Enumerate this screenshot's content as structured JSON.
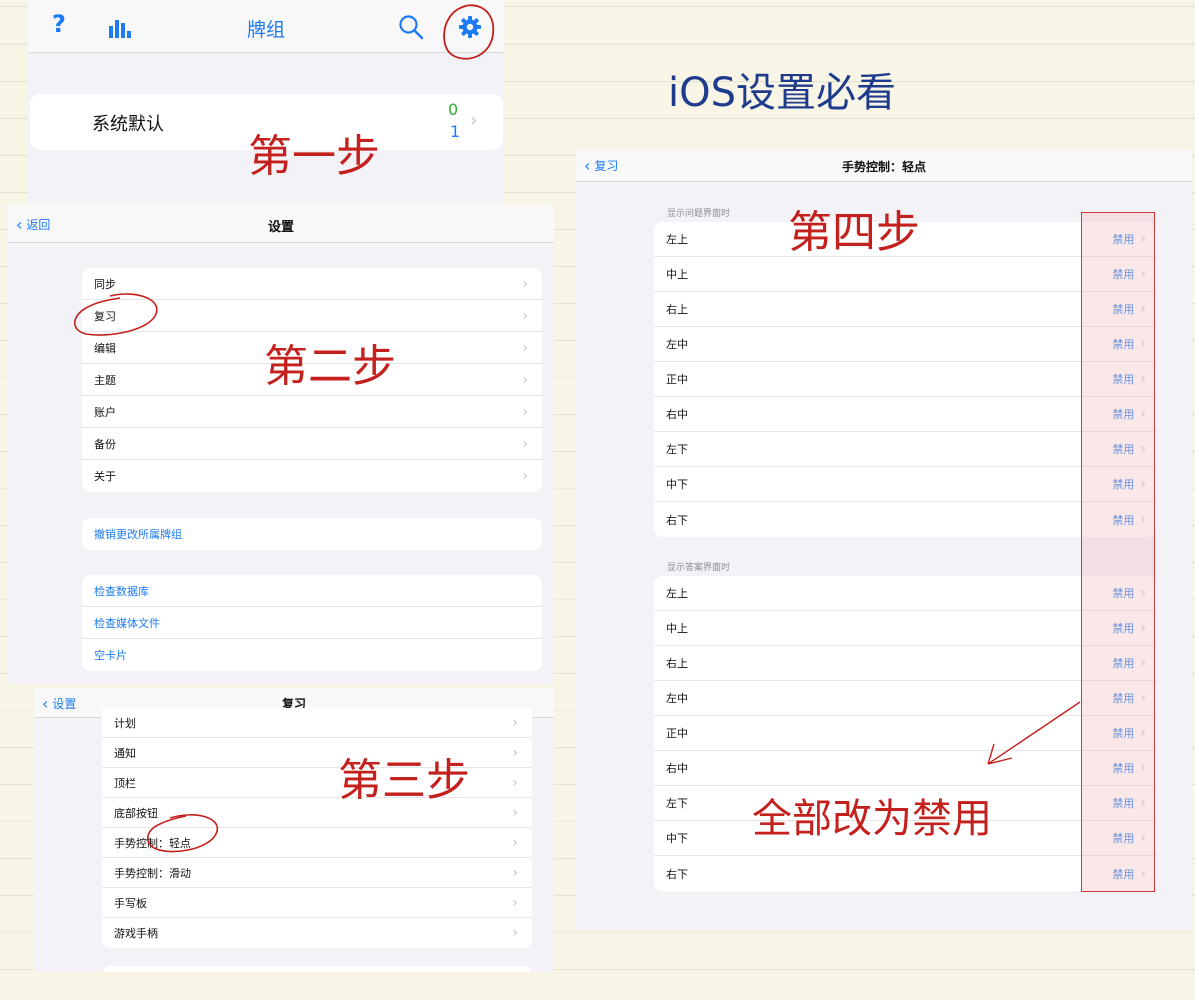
{
  "page_title": "iOS设置必看",
  "annotations": {
    "step1": "第一步",
    "step2": "第二步",
    "step3": "第三步",
    "step4": "第四步",
    "note": "全部改为禁用"
  },
  "panel1": {
    "help_icon": "?",
    "title": "牌组",
    "deck": {
      "name": "系统默认",
      "count_new": "0",
      "count_review": "1"
    }
  },
  "panel2": {
    "back_label": "返回",
    "title": "设置",
    "group1": [
      "同步",
      "复习",
      "编辑",
      "主题",
      "账户",
      "备份",
      "关于"
    ],
    "group2": [
      "撤销更改所属牌组"
    ],
    "group3": [
      "检查数据库",
      "检查媒体文件",
      "空卡片"
    ]
  },
  "panel3": {
    "back_label": "设置",
    "title": "复习",
    "items": [
      "计划",
      "通知",
      "顶栏",
      "底部按钮",
      "手势控制：轻点",
      "手势控制：滑动",
      "手写板",
      "游戏手柄"
    ]
  },
  "panel4": {
    "back_label": "复习",
    "title": "手势控制：轻点",
    "section1": {
      "header": "显示问题界面时",
      "rows": [
        {
          "label": "左上",
          "value": "禁用"
        },
        {
          "label": "中上",
          "value": "禁用"
        },
        {
          "label": "右上",
          "value": "禁用"
        },
        {
          "label": "左中",
          "value": "禁用"
        },
        {
          "label": "正中",
          "value": "禁用"
        },
        {
          "label": "右中",
          "value": "禁用"
        },
        {
          "label": "左下",
          "value": "禁用"
        },
        {
          "label": "中下",
          "value": "禁用"
        },
        {
          "label": "右下",
          "value": "禁用"
        }
      ]
    },
    "section2": {
      "header": "显示答案界面时",
      "rows": [
        {
          "label": "左上",
          "value": "禁用"
        },
        {
          "label": "中上",
          "value": "禁用"
        },
        {
          "label": "右上",
          "value": "禁用"
        },
        {
          "label": "左中",
          "value": "禁用"
        },
        {
          "label": "正中",
          "value": "禁用"
        },
        {
          "label": "右中",
          "value": "禁用"
        },
        {
          "label": "左下",
          "value": "禁用"
        },
        {
          "label": "中下",
          "value": "禁用"
        },
        {
          "label": "右下",
          "value": "禁用"
        }
      ]
    }
  },
  "colors": {
    "ios_blue": "#1d7bf2",
    "annotation_red": "#c4201d",
    "count_green": "#30b030",
    "highlight_pink": "#f7dcdc"
  }
}
